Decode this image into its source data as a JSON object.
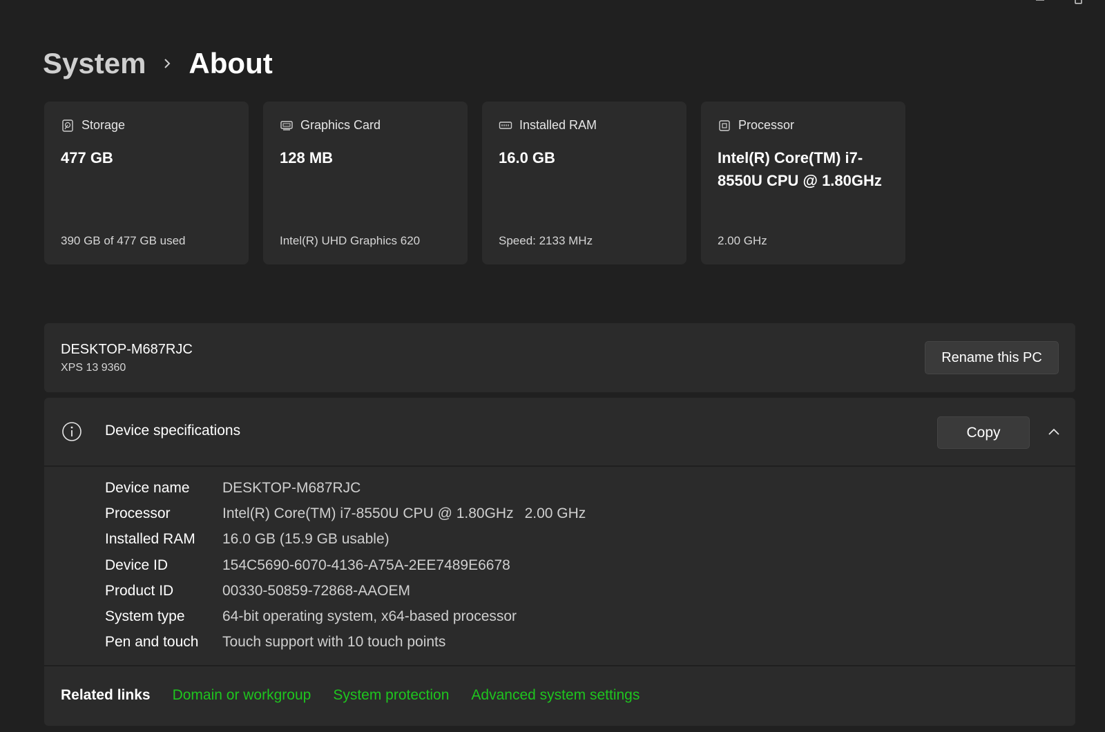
{
  "breadcrumb": {
    "parent": "System",
    "current": "About"
  },
  "cards": [
    {
      "icon": "storage-icon",
      "title": "Storage",
      "value": "477 GB",
      "sub": "390 GB of 477 GB used"
    },
    {
      "icon": "graphics-card-icon",
      "title": "Graphics Card",
      "value": "128 MB",
      "sub": "Intel(R) UHD Graphics 620"
    },
    {
      "icon": "ram-icon",
      "title": "Installed RAM",
      "value": "16.0 GB",
      "sub": "Speed: 2133 MHz"
    },
    {
      "icon": "processor-icon",
      "title": "Processor",
      "value": "Intel(R) Core(TM) i7-8550U CPU @ 1.80GHz",
      "sub": "2.00 GHz"
    }
  ],
  "device": {
    "name": "DESKTOP-M687RJC",
    "model": "XPS 13 9360",
    "rename_label": "Rename this PC"
  },
  "specs": {
    "title": "Device specifications",
    "copy_label": "Copy",
    "rows": [
      {
        "label": "Device name",
        "value": "DESKTOP-M687RJC"
      },
      {
        "label": "Processor",
        "value": "Intel(R) Core(TM) i7-8550U CPU @ 1.80GHz",
        "value2": "2.00 GHz"
      },
      {
        "label": "Installed RAM",
        "value": "16.0 GB (15.9 GB usable)"
      },
      {
        "label": "Device ID",
        "value": "154C5690-6070-4136-A75A-2EE7489E6678"
      },
      {
        "label": "Product ID",
        "value": "00330-50859-72868-AAOEM"
      },
      {
        "label": "System type",
        "value": "64-bit operating system, x64-based processor"
      },
      {
        "label": "Pen and touch",
        "value": "Touch support with 10 touch points"
      }
    ]
  },
  "related": {
    "label": "Related links",
    "links": [
      "Domain or workgroup",
      "System protection",
      "Advanced system settings"
    ],
    "link_color": "#1ec51e"
  },
  "colors": {
    "background": "#202020",
    "card": "#2b2b2b",
    "button": "#3a3a3a"
  }
}
